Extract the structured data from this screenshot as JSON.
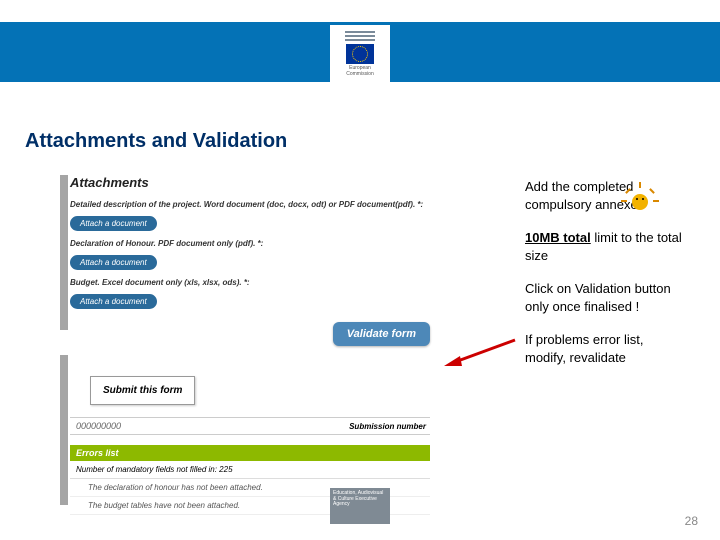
{
  "header": {
    "logo_line1": "European",
    "logo_line2": "Commission"
  },
  "title": "Attachments and Validation",
  "attachments": {
    "section_title": "Attachments",
    "items": [
      {
        "label": "Detailed description of the project. Word document (doc, docx, odt) or PDF document(pdf). *:",
        "button": "Attach a document"
      },
      {
        "label": "Declaration of Honour. PDF document only (pdf). *:",
        "button": "Attach a document"
      },
      {
        "label": "Budget. Excel document only (xls, xlsx, ods). *:",
        "button": "Attach a document"
      }
    ],
    "validate_button": "Validate form"
  },
  "submit": {
    "button": "Submit this form",
    "number_value": "000000000",
    "number_label": "Submission number"
  },
  "errors": {
    "header": "Errors list",
    "summary": "Number of mandatory fields not filled in: 225",
    "items": [
      "The declaration of honour has not been attached.",
      "The budget tables have not been attached."
    ]
  },
  "notes": {
    "n1": "Add the completed compulsory annexes",
    "n2_bold": "10MB total",
    "n2_rest": "limit to the total size",
    "n3": "Click on Validation button only once finalised !",
    "n4": "If problems error list, modify, revalidate"
  },
  "footer": {
    "agency": "Education, Audiovisual & Culture Executive Agency"
  },
  "page_number": "28"
}
